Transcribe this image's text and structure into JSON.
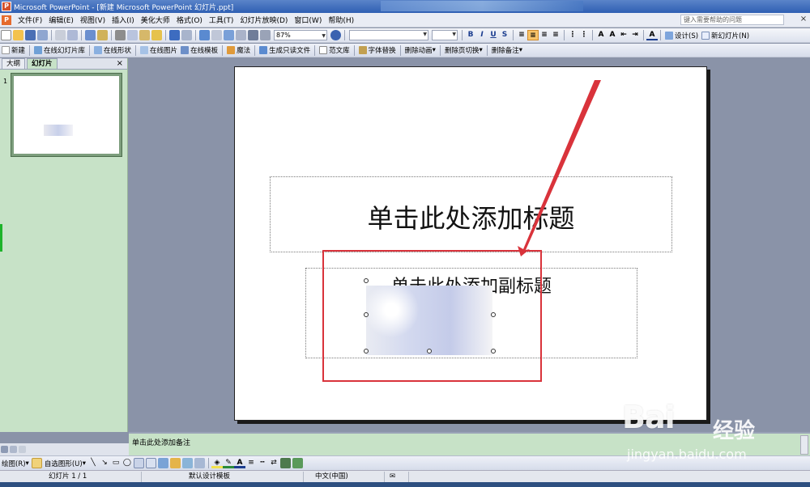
{
  "window": {
    "title": "Microsoft PowerPoint - [新建 Microsoft PowerPoint 幻灯片.ppt]"
  },
  "menu": {
    "items": [
      "文件(F)",
      "编辑(E)",
      "视图(V)",
      "插入(I)",
      "美化大师",
      "格式(O)",
      "工具(T)",
      "幻灯片放映(D)",
      "窗口(W)",
      "帮助(H)"
    ],
    "help_placeholder": "键入需要帮助的问题"
  },
  "toolbar": {
    "zoom": "87%",
    "design_label": "设计(S)",
    "new_slide_label": "新幻灯片(N)",
    "format_buttons": [
      "B",
      "I",
      "U",
      "S"
    ]
  },
  "addin_toolbar": {
    "items": [
      "新建",
      "在线幻灯片库",
      "在线形状",
      "在线图片",
      "在线模板",
      "魔法",
      "生成只读文件",
      "范文库",
      "字体替换",
      "删除动画",
      "删除页切换",
      "删除备注"
    ]
  },
  "outline_pane": {
    "tabs": [
      "大纲",
      "幻灯片"
    ],
    "active_tab": "幻灯片",
    "slide_number": "1"
  },
  "slide": {
    "title_placeholder": "单击此处添加标题",
    "subtitle_placeholder": "单击此处添加副标题"
  },
  "notes": {
    "placeholder": "单击此处添加备注"
  },
  "drawing_toolbar": {
    "draw_label": "绘图(R)",
    "autoshapes_label": "自选图形(U)"
  },
  "status_bar": {
    "slide_info": "幻灯片 1 / 1",
    "template": "默认设计模板",
    "language": "中文(中国)"
  },
  "watermark": {
    "brand": "Bai",
    "brand_cn": "经验",
    "url": "jingyan.baidu.com"
  },
  "colors": {
    "accent_red": "#d9333b",
    "pane_green": "#c7e2c7",
    "workspace": "#8a93a8"
  }
}
